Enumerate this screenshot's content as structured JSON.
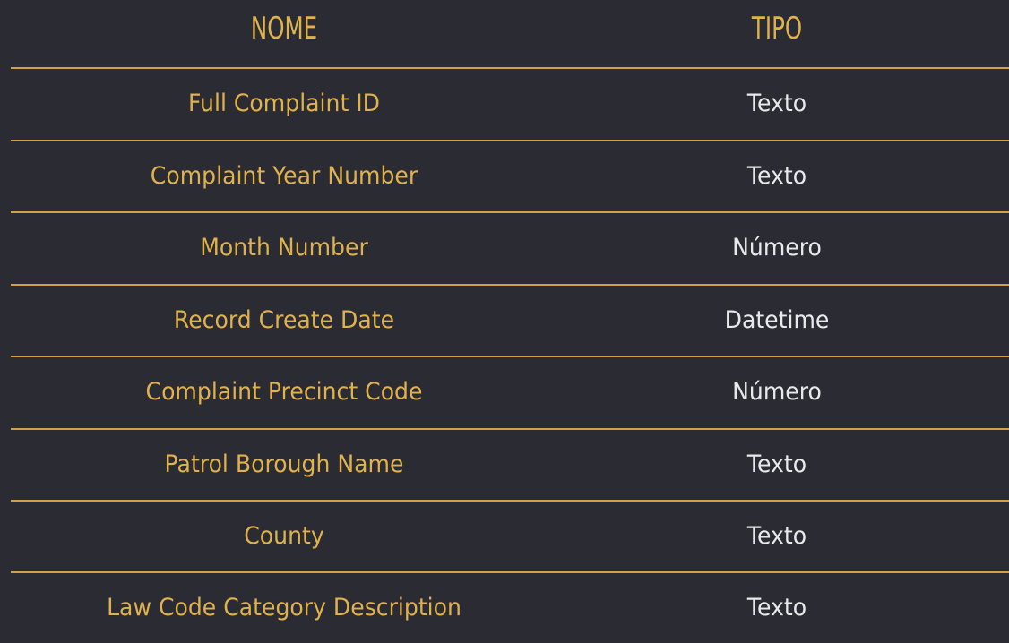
{
  "table": {
    "headers": {
      "name": "NOME",
      "type": "TIPO"
    },
    "rows": [
      {
        "name": "Full Complaint ID",
        "type": "Texto"
      },
      {
        "name": "Complaint Year Number",
        "type": "Texto"
      },
      {
        "name": "Month Number",
        "type": "Número"
      },
      {
        "name": "Record Create Date",
        "type": "Datetime"
      },
      {
        "name": "Complaint Precinct Code",
        "type": "Número"
      },
      {
        "name": "Patrol Borough Name",
        "type": "Texto"
      },
      {
        "name": "County",
        "type": "Texto"
      },
      {
        "name": "Law Code Category Description",
        "type": "Texto"
      }
    ]
  },
  "colors": {
    "background": "#2b2b33",
    "accent": "#e0b24e",
    "divider": "#cfa24a",
    "text": "#e9e9ec"
  }
}
